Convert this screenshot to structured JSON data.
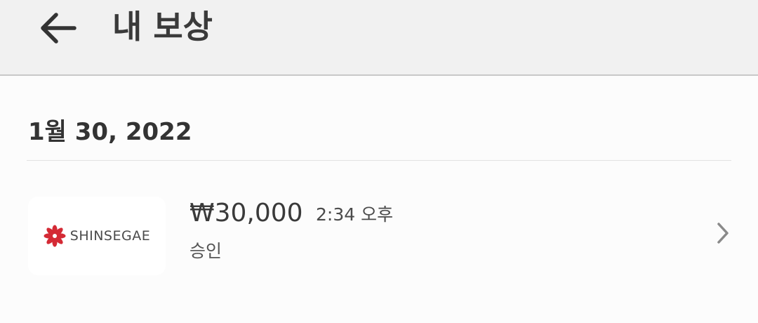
{
  "header": {
    "back_icon": "arrow-left-icon",
    "title": "내 보상"
  },
  "section": {
    "date": "1월 30, 2022"
  },
  "rewards": [
    {
      "merchant_logo_text": "SHINSEGAE",
      "amount": "₩30,000",
      "time": "2:34 오후",
      "status": "승인",
      "chevron_icon": "chevron-right-icon"
    }
  ],
  "colors": {
    "header_bg": "#f1f1f1",
    "page_bg": "#fcfcfc",
    "logo_red": "#d42a35",
    "text_dark": "#3a3a3a"
  }
}
